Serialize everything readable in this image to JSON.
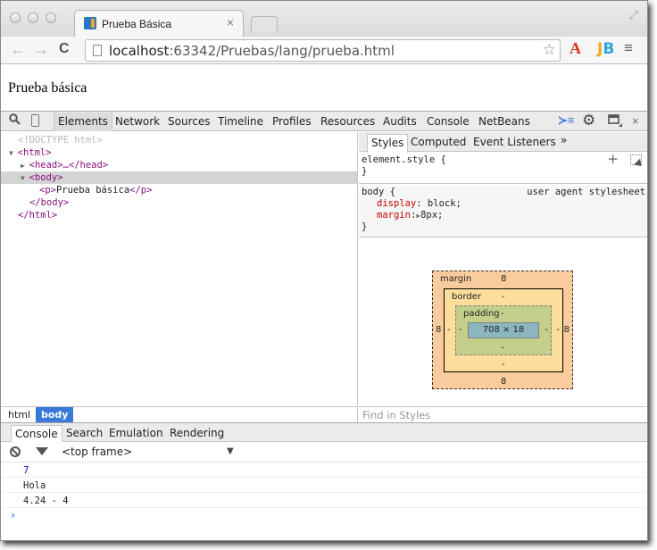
{
  "browser": {
    "tab_title": "Prueba Básica",
    "tab_close": "×",
    "url_host": "localhost",
    "url_rest": ":63342/Pruebas/lang/prueba.html",
    "icons": {
      "back": "←",
      "forward": "→",
      "reload": "C",
      "star": "☆",
      "ext_a": "A",
      "ext_jb_j": "J",
      "ext_jb_b": "B",
      "menu": "≡",
      "fullscreen": "⤢"
    }
  },
  "page": {
    "paragraph": "Prueba básica"
  },
  "devtools": {
    "tabs": [
      "Elements",
      "Network",
      "Sources",
      "Timeline",
      "Profiles",
      "Resources",
      "Audits",
      "Console",
      "NetBeans"
    ],
    "active_tab": "Elements",
    "icons": {
      "search": "🔍",
      "device": "▯",
      "drawer": "≻≡",
      "settings": "⚙",
      "dock": "▭",
      "close": "×"
    },
    "dom": {
      "doctype": "<!DOCTYPE html>",
      "html_open": "<html>",
      "head": "<head>…</head>",
      "body_open": "<body>",
      "p_open": "<p>",
      "p_text": "Prueba básica",
      "p_close": "</p>",
      "body_close": "</body>",
      "html_close": "</html>"
    },
    "breadcrumb": [
      "html",
      "body"
    ],
    "styles": {
      "tabs": [
        "Styles",
        "Computed",
        "Event Listeners",
        "»"
      ],
      "element_style_selector": "element.style {",
      "close_brace": "}",
      "body_selector": "body {",
      "origin": "user agent stylesheet",
      "props": [
        {
          "name": "display",
          "value": "block;"
        },
        {
          "name": "margin",
          "value": "8px;"
        }
      ],
      "add_icon": "+",
      "find_placeholder": "Find in Styles"
    },
    "box_model": {
      "margin_label": "margin",
      "border_label": "border",
      "padding_label": "padding",
      "margin": {
        "top": "8",
        "right": "8",
        "bottom": "8",
        "left": "8"
      },
      "border": {
        "top": "-",
        "right": "-",
        "bottom": "-",
        "left": "-"
      },
      "padding": {
        "top": "-",
        "right": "-",
        "bottom": "-",
        "left": "-"
      },
      "content": "708 × 18"
    },
    "drawer": {
      "tabs": [
        "Console",
        "Search",
        "Emulation",
        "Rendering"
      ],
      "active_tab": "Console",
      "frame": "<top frame>",
      "frame_arrow": "▼",
      "messages": [
        "7",
        "Hola",
        "4.24 - 4"
      ],
      "prompt": "›"
    }
  }
}
